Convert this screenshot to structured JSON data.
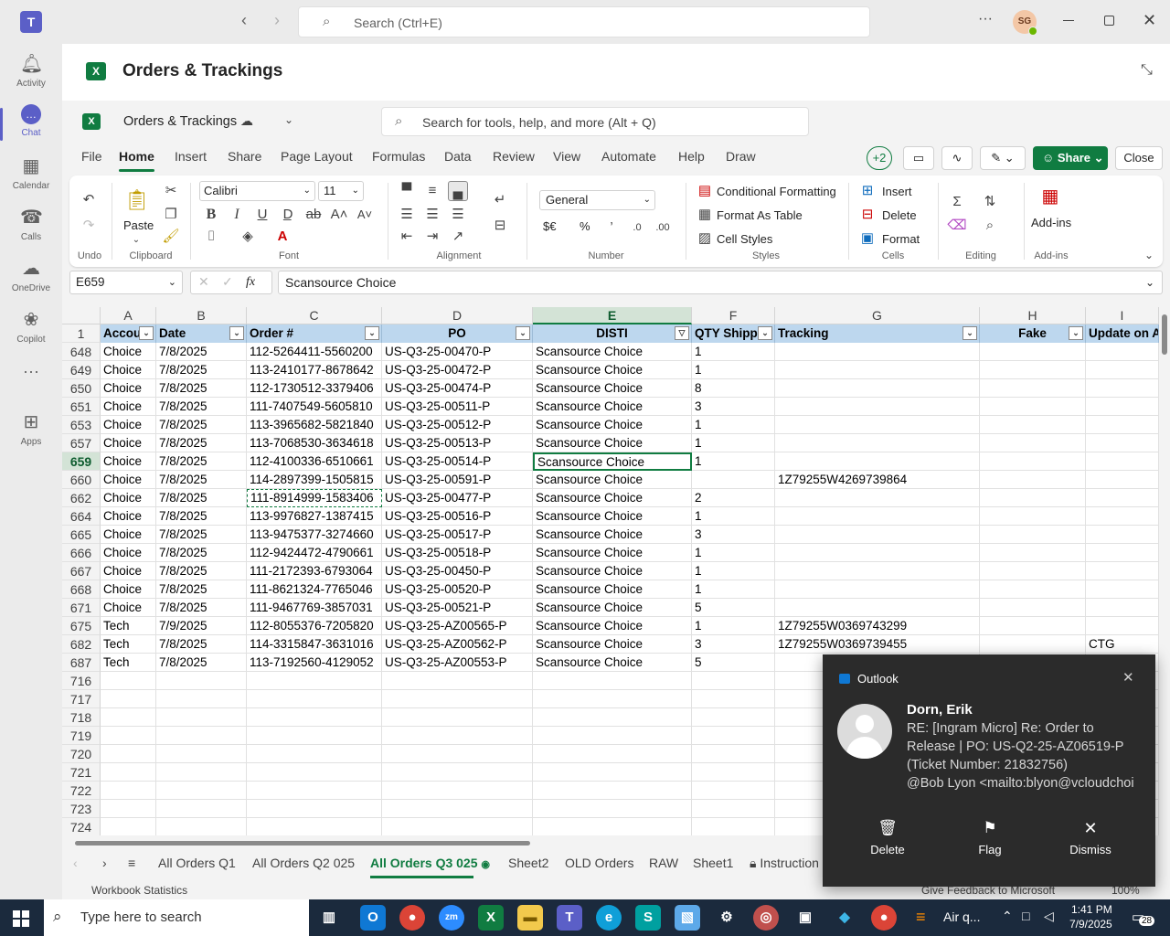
{
  "teams": {
    "search_placeholder": "Search (Ctrl+E)",
    "avatar": "SG",
    "more": "···",
    "rail": [
      {
        "label": "Activity",
        "icon": "bell-icon"
      },
      {
        "label": "Chat",
        "icon": "chat-icon"
      },
      {
        "label": "Calendar",
        "icon": "calendar-icon"
      },
      {
        "label": "Calls",
        "icon": "phone-icon"
      },
      {
        "label": "OneDrive",
        "icon": "cloud-icon"
      },
      {
        "label": "Copilot",
        "icon": "copilot-icon"
      },
      {
        "label": "···",
        "icon": "more-icon"
      },
      {
        "label": "Apps",
        "icon": "apps-icon"
      }
    ]
  },
  "app": {
    "title": "Orders & Trackings",
    "doc_name": "Orders & Trackings",
    "tools_search": "Search for tools, help, and more (Alt + Q)"
  },
  "menu": {
    "tabs": [
      "File",
      "Home",
      "Insert",
      "Share",
      "Page Layout",
      "Formulas",
      "Data",
      "Review",
      "View",
      "Automate",
      "Help",
      "Draw"
    ],
    "coauthors": "+2",
    "share": "Share",
    "close": "Close"
  },
  "ribbon": {
    "undo": "Undo",
    "paste": "Paste",
    "clipboard": "Clipboard",
    "font_name": "Calibri",
    "font_size": "11",
    "font": "Font",
    "alignment": "Alignment",
    "number_format": "General",
    "number": "Number",
    "currency": "$€",
    "percent": "%",
    "conditional": "Conditional Formatting",
    "format_table": "Format As Table",
    "cell_styles": "Cell Styles",
    "styles": "Styles",
    "insert": "Insert",
    "delete": "Delete",
    "format": "Format",
    "cells": "Cells",
    "editing": "Editing",
    "addins_btn": "Add-ins",
    "addins": "Add-ins",
    "bold": "B",
    "italic": "I",
    "underline": "U"
  },
  "formula": {
    "name_box": "E659",
    "fx": "fx",
    "value": "Scansource Choice"
  },
  "grid": {
    "columns": [
      "A",
      "B",
      "C",
      "D",
      "E",
      "F",
      "G",
      "H",
      "I"
    ],
    "headers": [
      "Accou",
      "Date",
      "Order #",
      "PO",
      "DISTI",
      "QTY Shippe",
      "Tracking",
      "Fake",
      "Update on Ar"
    ],
    "header_row": "1",
    "rows": [
      {
        "n": "648",
        "a": "Choice",
        "b": "7/8/2025",
        "c": "112-5264411-5560200",
        "d": "US-Q3-25-00470-P",
        "e": "Scansource Choice",
        "f": "1",
        "g": "",
        "i": ""
      },
      {
        "n": "649",
        "a": "Choice",
        "b": "7/8/2025",
        "c": "113-2410177-8678642",
        "d": "US-Q3-25-00472-P",
        "e": "Scansource Choice",
        "f": "1",
        "g": "",
        "i": ""
      },
      {
        "n": "650",
        "a": "Choice",
        "b": "7/8/2025",
        "c": "112-1730512-3379406",
        "d": "US-Q3-25-00474-P",
        "e": "Scansource Choice",
        "f": "8",
        "g": "",
        "i": ""
      },
      {
        "n": "651",
        "a": "Choice",
        "b": "7/8/2025",
        "c": "111-7407549-5605810",
        "d": "US-Q3-25-00511-P",
        "e": "Scansource Choice",
        "f": "3",
        "g": "",
        "i": ""
      },
      {
        "n": "653",
        "a": "Choice",
        "b": "7/8/2025",
        "c": "113-3965682-5821840",
        "d": "US-Q3-25-00512-P",
        "e": "Scansource Choice",
        "f": "1",
        "g": "",
        "i": ""
      },
      {
        "n": "657",
        "a": "Choice",
        "b": "7/8/2025",
        "c": "113-7068530-3634618",
        "d": "US-Q3-25-00513-P",
        "e": "Scansource Choice",
        "f": "1",
        "g": "",
        "i": ""
      },
      {
        "n": "659",
        "a": "Choice",
        "b": "7/8/2025",
        "c": "112-4100336-6510661",
        "d": "US-Q3-25-00514-P",
        "e": "Scansource Choice",
        "f": "1",
        "g": "",
        "i": ""
      },
      {
        "n": "660",
        "a": "Choice",
        "b": "7/8/2025",
        "c": "114-2897399-1505815",
        "d": "US-Q3-25-00591-P",
        "e": "Scansource Choice",
        "f": "",
        "g": "1Z79255W4269739864",
        "i": ""
      },
      {
        "n": "662",
        "a": "Choice",
        "b": "7/8/2025",
        "c": "111-8914999-1583406",
        "d": "US-Q3-25-00477-P",
        "e": "Scansource Choice",
        "f": "2",
        "g": "",
        "i": ""
      },
      {
        "n": "664",
        "a": "Choice",
        "b": "7/8/2025",
        "c": "113-9976827-1387415",
        "d": "US-Q3-25-00516-P",
        "e": "Scansource Choice",
        "f": "1",
        "g": "",
        "i": ""
      },
      {
        "n": "665",
        "a": "Choice",
        "b": "7/8/2025",
        "c": "113-9475377-3274660",
        "d": "US-Q3-25-00517-P",
        "e": "Scansource Choice",
        "f": "3",
        "g": "",
        "i": ""
      },
      {
        "n": "666",
        "a": "Choice",
        "b": "7/8/2025",
        "c": "112-9424472-4790661",
        "d": "US-Q3-25-00518-P",
        "e": "Scansource Choice",
        "f": "1",
        "g": "",
        "i": ""
      },
      {
        "n": "667",
        "a": "Choice",
        "b": "7/8/2025",
        "c": "111-2172393-6793064",
        "d": "US-Q3-25-00450-P",
        "e": "Scansource Choice",
        "f": "1",
        "g": "",
        "i": ""
      },
      {
        "n": "668",
        "a": "Choice",
        "b": "7/8/2025",
        "c": "111-8621324-7765046",
        "d": "US-Q3-25-00520-P",
        "e": "Scansource Choice",
        "f": "1",
        "g": "",
        "i": ""
      },
      {
        "n": "671",
        "a": "Choice",
        "b": "7/8/2025",
        "c": "111-9467769-3857031",
        "d": "US-Q3-25-00521-P",
        "e": "Scansource Choice",
        "f": "5",
        "g": "",
        "i": ""
      },
      {
        "n": "675",
        "a": "Tech",
        "b": "7/9/2025",
        "c": "112-8055376-7205820",
        "d": "US-Q3-25-AZ00565-P",
        "e": "Scansource Choice",
        "f": "1",
        "g": "1Z79255W0369743299",
        "i": ""
      },
      {
        "n": "682",
        "a": "Tech",
        "b": "7/8/2025",
        "c": "114-3315847-3631016",
        "d": "US-Q3-25-AZ00562-P",
        "e": "Scansource Choice",
        "f": "3",
        "g": "1Z79255W0369739455",
        "i": "CTG"
      },
      {
        "n": "687",
        "a": "Tech",
        "b": "7/8/2025",
        "c": "113-7192560-4129052",
        "d": "US-Q3-25-AZ00553-P",
        "e": "Scansource Choice",
        "f": "5",
        "g": "",
        "i": ""
      }
    ],
    "empty_rows": [
      "716",
      "717",
      "718",
      "719",
      "720",
      "721",
      "722",
      "723",
      "724"
    ]
  },
  "sheets": [
    "All Orders Q1",
    "All Orders Q2 025",
    "All Orders Q3 025",
    "Sheet2",
    "OLD Orders",
    "RAW",
    "Sheet1",
    "Instruction"
  ],
  "status": {
    "left": "Workbook Statistics",
    "feedback": "Give Feedback to Microsoft",
    "zoom": "100%"
  },
  "toast": {
    "app": "Outlook",
    "sender": "Dorn, Erik",
    "line1": "RE: [Ingram Micro] Re: Order to",
    "line2": "Release | PO: US-Q2-25-AZ06519-P",
    "line3": "(Ticket Number: 21832756)",
    "line4": "@Bob Lyon <mailto:blyon@vcloudchoi",
    "delete": "Delete",
    "flag": "Flag",
    "dismiss": "Dismiss"
  },
  "taskbar": {
    "search": "Type here to search",
    "weather": "Air q...",
    "time": "1:41 PM",
    "date": "7/9/2025",
    "notif": "28"
  }
}
